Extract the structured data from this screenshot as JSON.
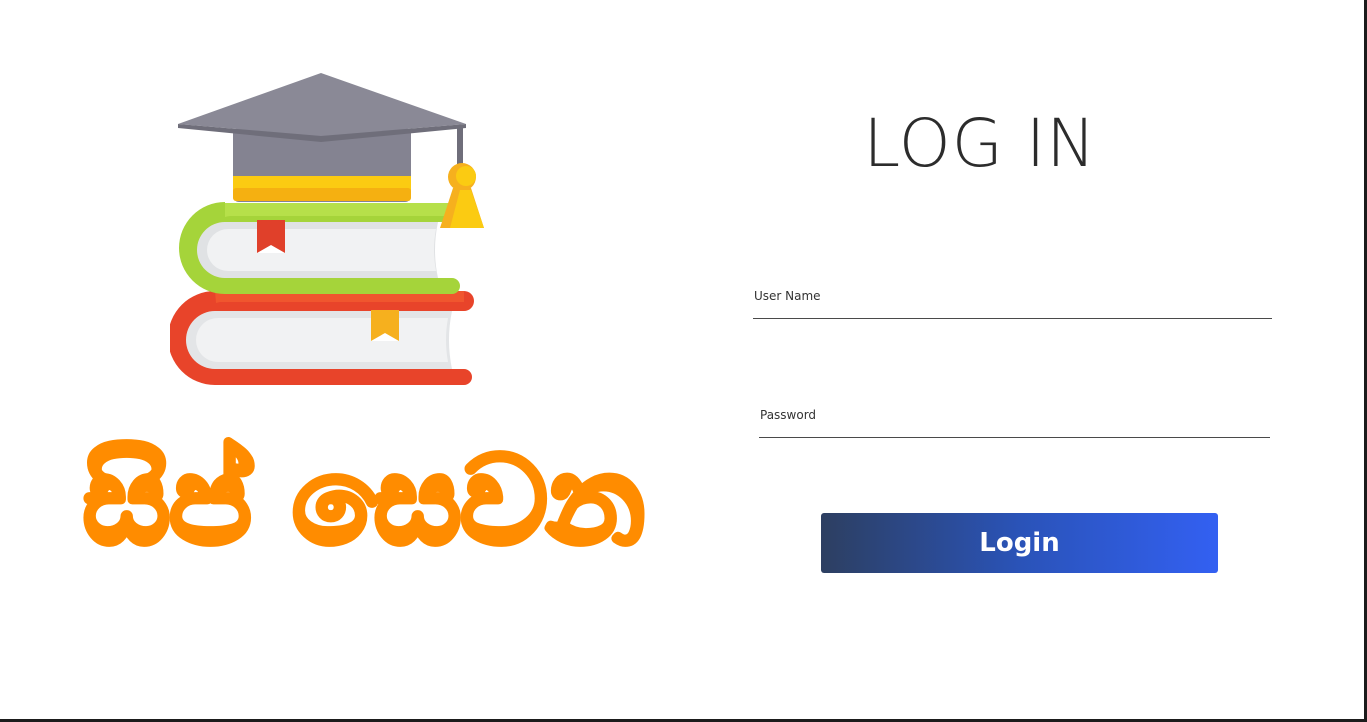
{
  "brand": {
    "logo_text": "සිප් සෙවන",
    "logo_icon": "graduation-cap-books-icon",
    "logo_text_color": "#ff8c00"
  },
  "login": {
    "title": "LOG IN",
    "username_label": "User Name",
    "username_value": "",
    "password_label": "Password",
    "password_value": "",
    "button_label": "Login"
  },
  "colors": {
    "button_gradient_start": "#2d3f61",
    "button_gradient_end": "#3360f2",
    "title_color": "#2c2c2c"
  }
}
